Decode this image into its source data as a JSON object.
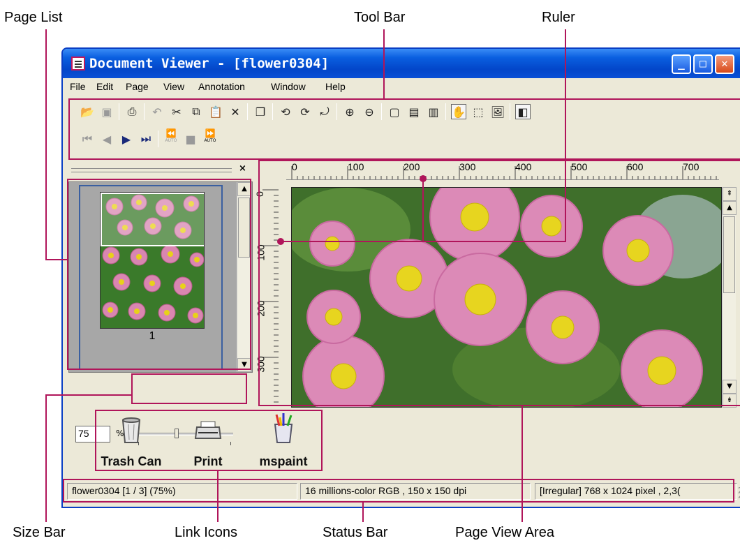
{
  "callouts": {
    "page_list": "Page List",
    "tool_bar": "Tool Bar",
    "ruler": "Ruler",
    "size_bar": "Size Bar",
    "link_icons": "Link Icons",
    "status_bar": "Status Bar",
    "page_view_area": "Page View Area"
  },
  "accent_color": "#b0155a",
  "window": {
    "title": "Document Viewer - [flower0304]",
    "buttons": [
      "minimize-icon",
      "maximize-icon",
      "close-icon"
    ]
  },
  "menu": [
    "File",
    "Edit",
    "Page",
    "View",
    "Annotation",
    "Window",
    "Help"
  ],
  "toolbar": {
    "row1_icons": [
      "open-icon",
      "save-icon",
      "print-icon",
      "undo-icon",
      "cut-icon",
      "copy-icon",
      "paste-icon",
      "delete-icon",
      "duplicate-icon",
      "rotate-left-icon",
      "rotate-right-icon",
      "rotate-180-icon",
      "zoom-in-icon",
      "zoom-out-icon",
      "fit-page-icon",
      "fit-width-icon",
      "fit-height-icon",
      "hand-tool-icon",
      "select-area-icon",
      "image-icon",
      "thumbnail-view-icon"
    ],
    "row2_icons": [
      "first-page-icon",
      "previous-page-icon",
      "next-page-icon",
      "last-page-icon",
      "auto-back-icon",
      "stop-icon",
      "auto-forward-icon"
    ],
    "auto_label": "AUTO"
  },
  "page_list": {
    "close_glyph": "×",
    "page_number": "1"
  },
  "size_bar": {
    "zoom_value": "75",
    "unit": "%",
    "slider_fraction": 0.42
  },
  "ruler": {
    "h_labels": [
      "0",
      "100",
      "200",
      "300",
      "400",
      "500",
      "600",
      "700"
    ],
    "v_labels": [
      "0",
      "100",
      "200",
      "300"
    ]
  },
  "link_icons": [
    {
      "label": "Trash Can",
      "icon": "trash-can-icon"
    },
    {
      "label": "Print",
      "icon": "printer-icon"
    },
    {
      "label": "mspaint",
      "icon": "paint-icon"
    }
  ],
  "status": {
    "file": "flower0304 [1 / 3] (75%)",
    "color": "16 millions-color RGB ,  150 x 150 dpi",
    "size": "[Irregular]  768 x 1024 pixel , 2,3("
  }
}
